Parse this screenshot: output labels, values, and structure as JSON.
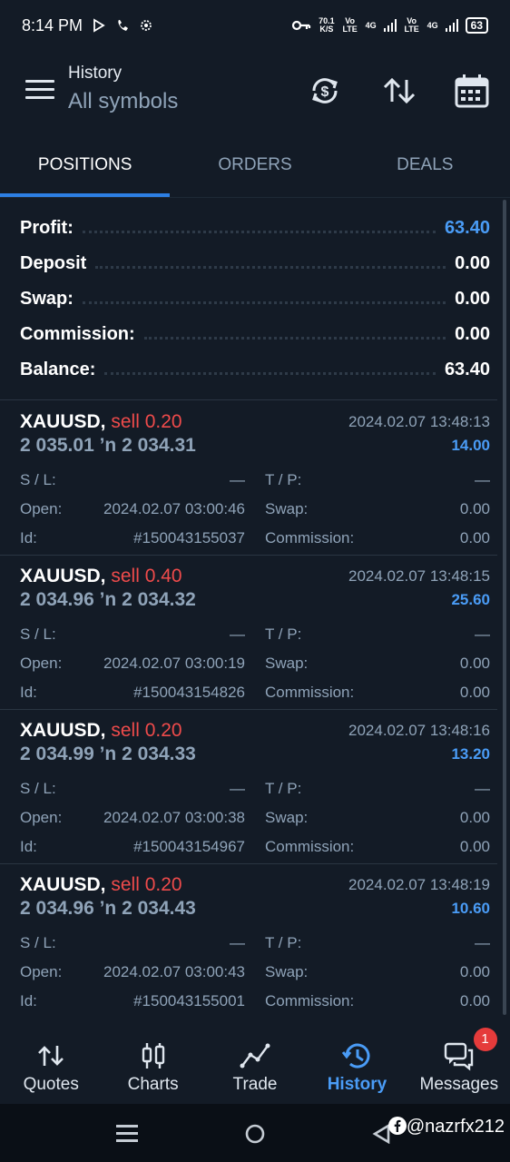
{
  "status_bar": {
    "time": "8:14 PM",
    "speed": "70.1",
    "speed_unit": "K/S",
    "volte1": "Vo LTE",
    "net1": "4G",
    "volte2": "Vo LTE",
    "net2": "4G",
    "battery": "63"
  },
  "header": {
    "title": "History",
    "subtitle": "All symbols"
  },
  "tabs": [
    "POSITIONS",
    "ORDERS",
    "DEALS"
  ],
  "summary": [
    {
      "label": "Profit:",
      "value": "63.40",
      "highlight": true
    },
    {
      "label": "Deposit",
      "value": "0.00",
      "highlight": false
    },
    {
      "label": "Swap:",
      "value": "0.00",
      "highlight": false
    },
    {
      "label": "Commission:",
      "value": "0.00",
      "highlight": false
    },
    {
      "label": "Balance:",
      "value": "63.40",
      "highlight": false
    }
  ],
  "position_labels": {
    "sl": "S / L:",
    "tp": "T / P:",
    "open": "Open:",
    "swap": "Swap:",
    "id": "Id:",
    "commission": "Commission:"
  },
  "positions": [
    {
      "symbol": "XAUUSD,",
      "side": "sell 0.20",
      "close_time": "2024.02.07 13:48:13",
      "prices": "2 035.01 ’n  2 034.31",
      "profit": "14.00",
      "sl": "—",
      "tp": "—",
      "open_time": "2024.02.07 03:00:46",
      "swap": "0.00",
      "id": "#150043155037",
      "commission": "0.00"
    },
    {
      "symbol": "XAUUSD,",
      "side": "sell 0.40",
      "close_time": "2024.02.07 13:48:15",
      "prices": "2 034.96 ’n  2 034.32",
      "profit": "25.60",
      "sl": "—",
      "tp": "—",
      "open_time": "2024.02.07 03:00:19",
      "swap": "0.00",
      "id": "#150043154826",
      "commission": "0.00"
    },
    {
      "symbol": "XAUUSD,",
      "side": "sell 0.20",
      "close_time": "2024.02.07 13:48:16",
      "prices": "2 034.99 ’n  2 034.33",
      "profit": "13.20",
      "sl": "—",
      "tp": "—",
      "open_time": "2024.02.07 03:00:38",
      "swap": "0.00",
      "id": "#150043154967",
      "commission": "0.00"
    },
    {
      "symbol": "XAUUSD,",
      "side": "sell 0.20",
      "close_time": "2024.02.07 13:48:19",
      "prices": "2 034.96 ’n  2 034.43",
      "profit": "10.60",
      "sl": "—",
      "tp": "—",
      "open_time": "2024.02.07 03:00:43",
      "swap": "0.00",
      "id": "#150043155001",
      "commission": "0.00"
    }
  ],
  "bottom_nav": [
    {
      "label": "Quotes",
      "icon": "quotes-icon",
      "active": false
    },
    {
      "label": "Charts",
      "icon": "charts-icon",
      "active": false
    },
    {
      "label": "Trade",
      "icon": "trade-icon",
      "active": false
    },
    {
      "label": "History",
      "icon": "history-icon",
      "active": true
    },
    {
      "label": "Messages",
      "icon": "messages-icon",
      "active": false,
      "badge": "1"
    }
  ],
  "watermark": "@nazrfx212",
  "colors": {
    "background": "#131b26",
    "accent": "#4a9cf6",
    "sell": "#ef4b4b",
    "muted": "#8fa3b8"
  }
}
